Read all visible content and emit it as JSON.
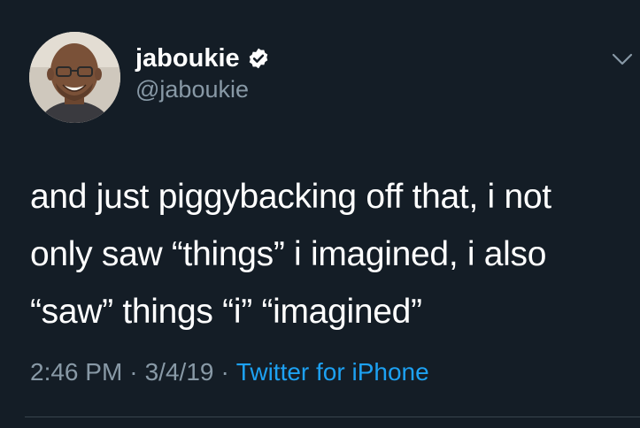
{
  "tweet": {
    "author": {
      "display_name": "jaboukie",
      "handle": "@jaboukie",
      "verified": true
    },
    "text": "and just piggybacking off that, i not\nonly saw “things” i imagined, i also\n“saw” things “i” “imagined”",
    "time": "2:46 PM",
    "date": "3/4/19",
    "separator": "·",
    "source": "Twitter for iPhone"
  },
  "icons": {
    "verified": "verified-badge-icon",
    "menu": "chevron-down-icon"
  },
  "colors": {
    "background": "#141d26",
    "text": "#ffffff",
    "secondary": "#8899a6",
    "link": "#1da1f2",
    "divider": "#38444d"
  }
}
